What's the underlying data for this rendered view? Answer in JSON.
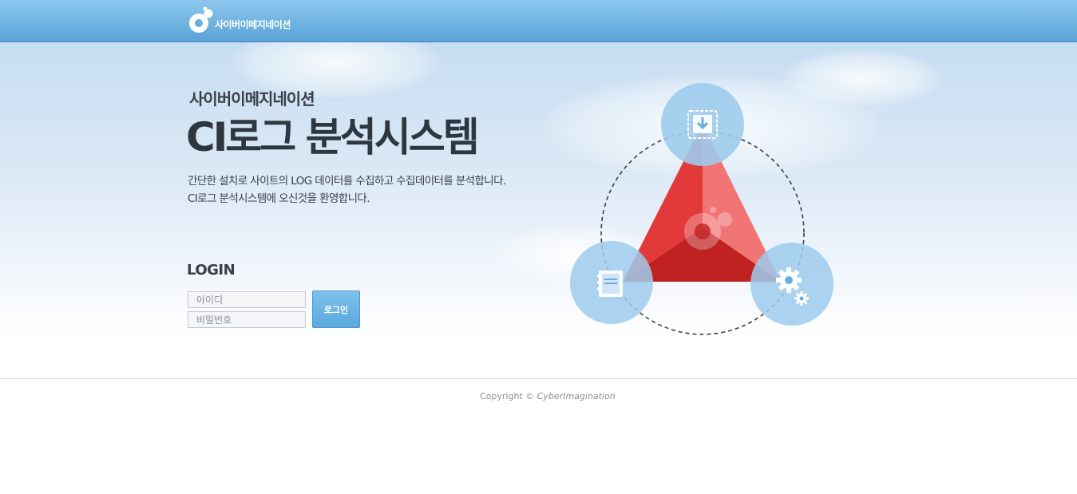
{
  "header": {
    "brand_name": "사이버이메지네이션"
  },
  "hero": {
    "subtitle": "사이버이메지네이션",
    "title": "CI로그 분석시스템",
    "description_line1": "간단한 설치로 사이트의 LOG 데이터를 수집하고 수집데이터를 분석합니다.",
    "description_line2": "CI로그 분석시스템에 오신것을 환영합니다."
  },
  "login": {
    "heading": "LOGIN",
    "id_placeholder": "아이디",
    "password_placeholder": "비밀번호",
    "button_label": "로그인"
  },
  "footer": {
    "copyright_prefix": "Copyright ©",
    "copyright_brand": "CyberImagination"
  },
  "colors": {
    "header_blue": "#6aafdf",
    "triangle_red": "#e23a3a",
    "circle_blue": "#9ecbec",
    "button_blue": "#6ab4e4"
  },
  "icons": {
    "top_node": "download-icon",
    "left_node": "document-icon",
    "right_node": "gear-icon",
    "logo": "logo-bubble-icon"
  }
}
